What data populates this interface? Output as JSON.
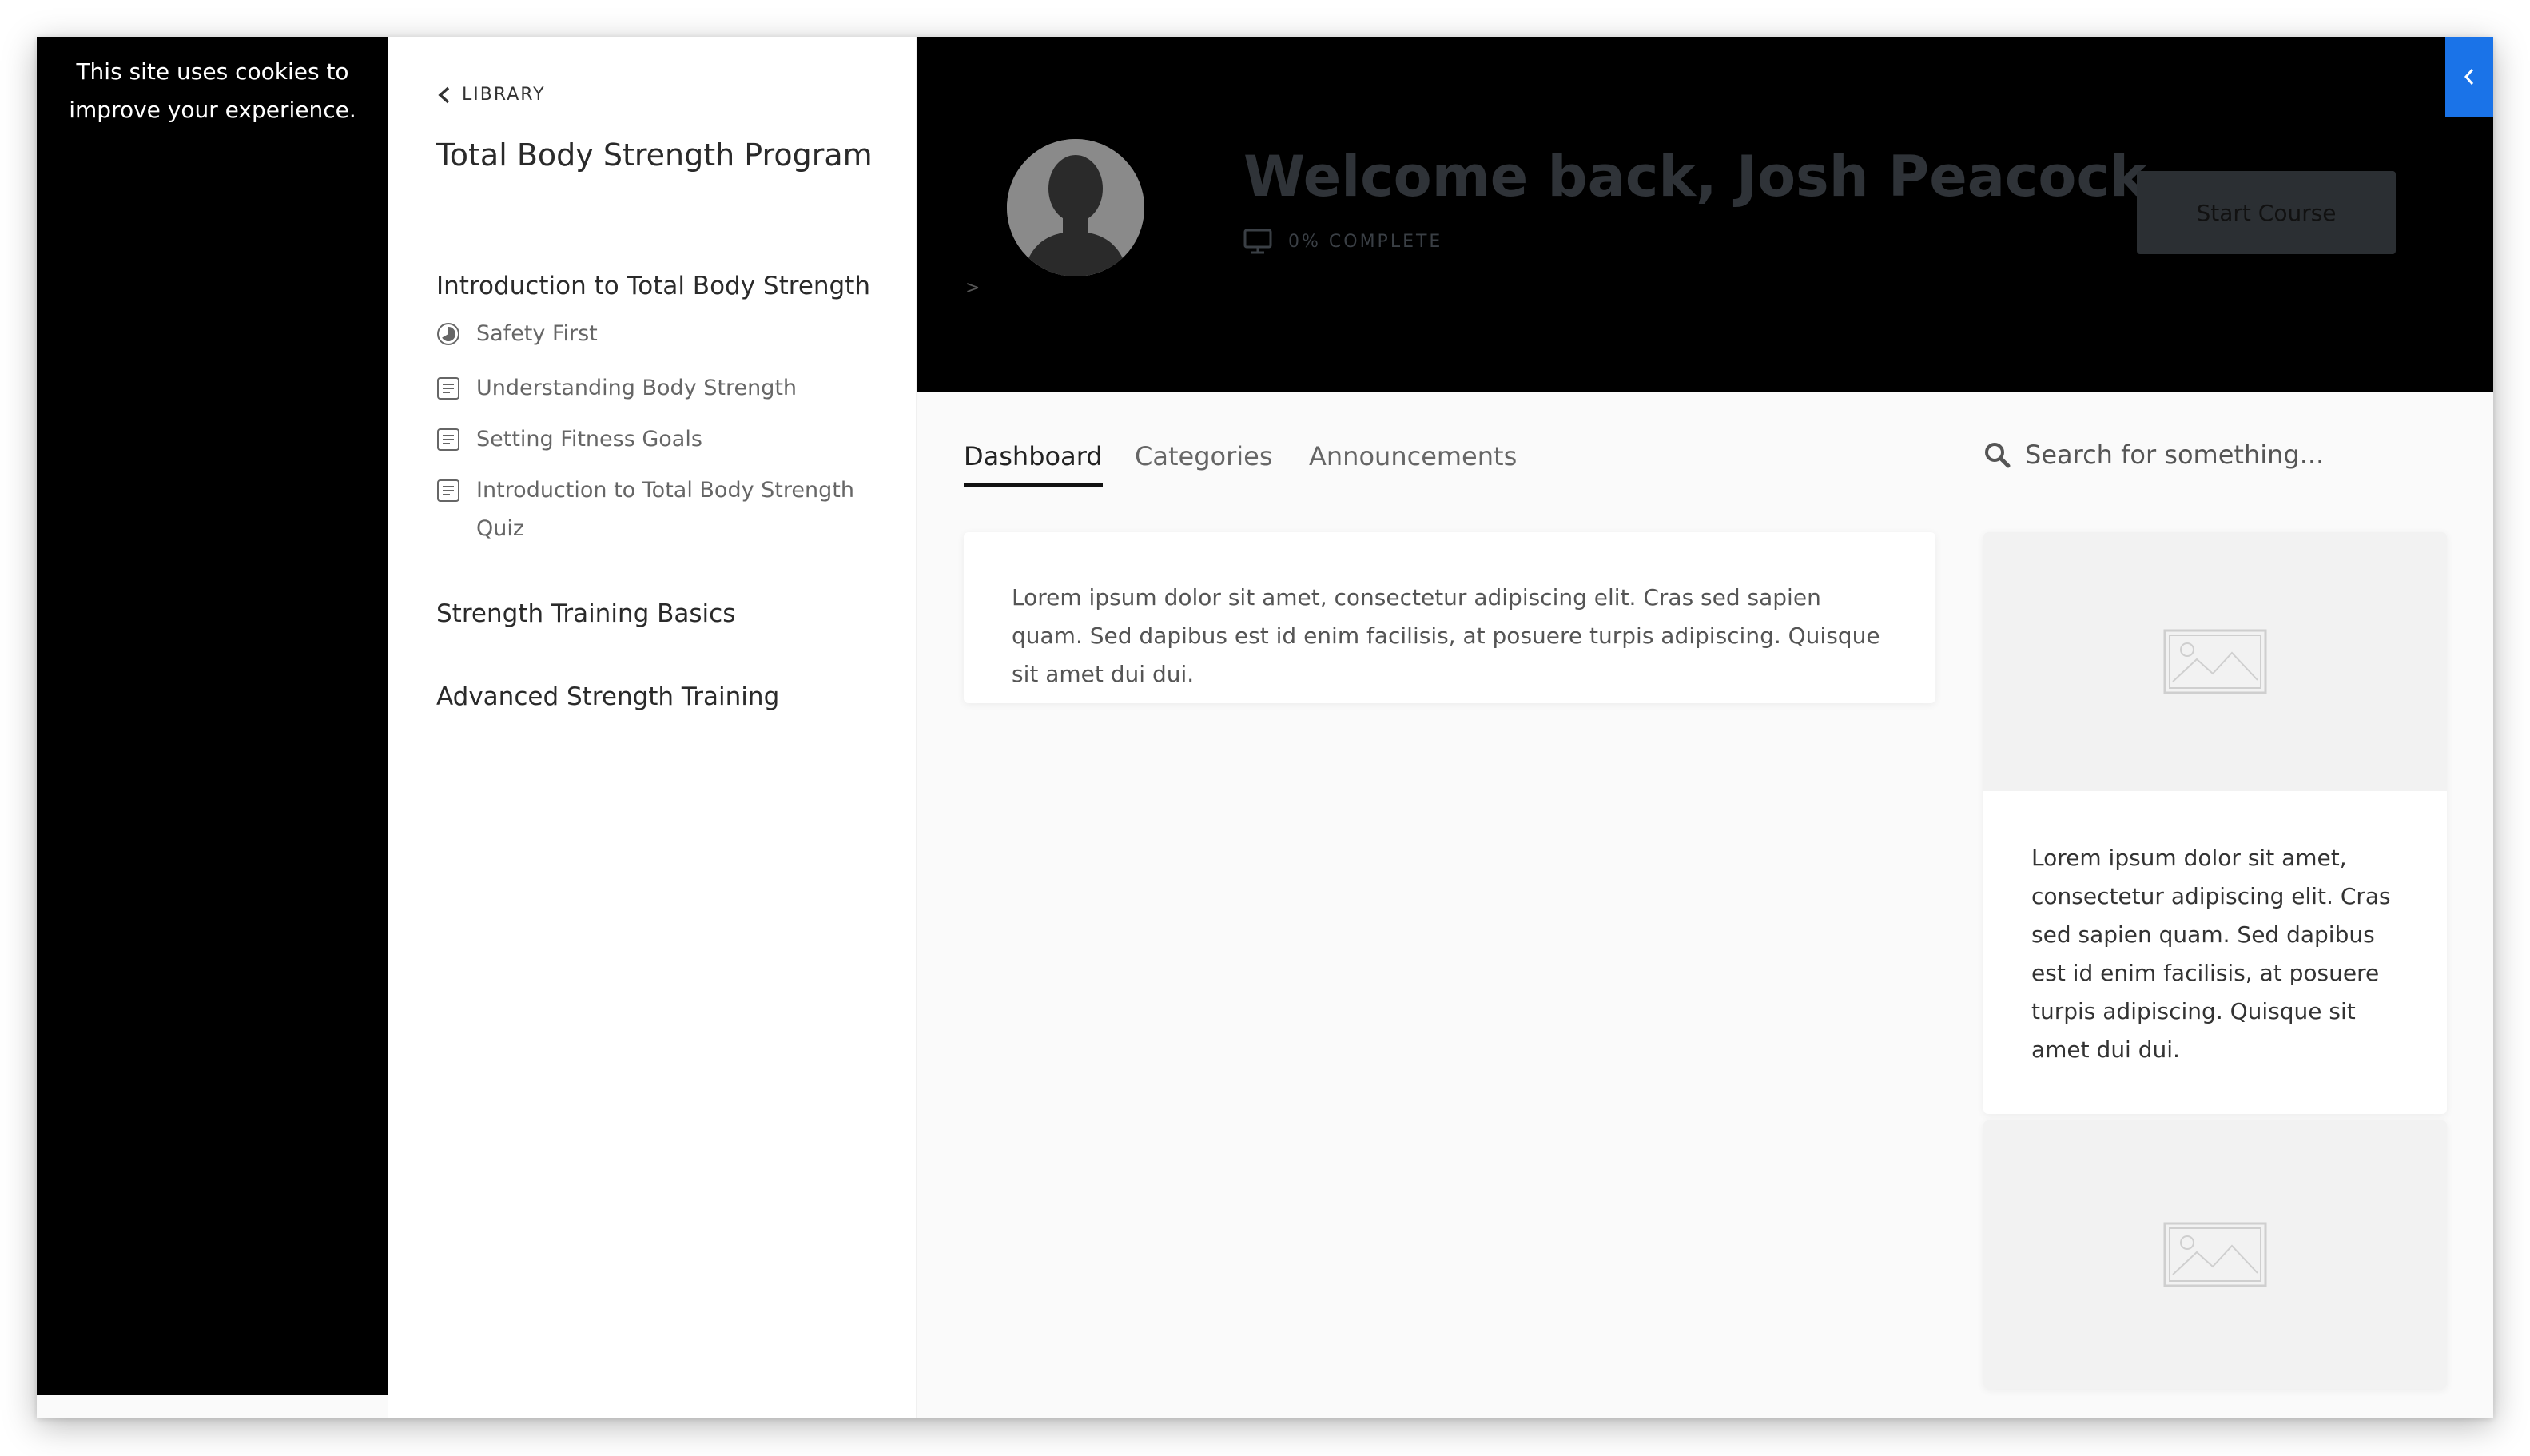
{
  "cookie_notice": {
    "text": "This site uses cookies to improve your experience."
  },
  "sidebar": {
    "back_label": "LIBRARY",
    "course_title": "Total Body Strength Program",
    "sections": [
      {
        "title": "Introduction to Total Body Strength",
        "lessons": [
          {
            "label": "Safety First",
            "icon": "progress-circle-icon"
          },
          {
            "label": "Understanding Body Strength",
            "icon": "document-icon"
          },
          {
            "label": "Setting Fitness Goals",
            "icon": "document-icon"
          },
          {
            "label": "Introduction to Total Body Strength Quiz",
            "icon": "document-icon"
          }
        ]
      },
      {
        "title": "Strength Training Basics",
        "lessons": []
      },
      {
        "title": "Advanced Strength Training",
        "lessons": []
      }
    ]
  },
  "header": {
    "welcome": "Welcome back, Josh Peacock",
    "progress_text": "0% COMPLETE",
    "caret": ">",
    "start_button": "Start Course",
    "colors": {
      "banner_bg": "#000000",
      "collapse_button_bg": "#1a73e8"
    }
  },
  "tabs": [
    {
      "label": "Dashboard",
      "active": true
    },
    {
      "label": "Categories",
      "active": false
    },
    {
      "label": "Announcements",
      "active": false
    }
  ],
  "search": {
    "placeholder": "Search for something..."
  },
  "main_card": {
    "text": "Lorem ipsum dolor sit amet, consectetur adipiscing elit. Cras sed sapien quam. Sed dapibus est id enim facilisis, at posuere turpis adipiscing. Quisque sit amet dui dui."
  },
  "side_cards": [
    {
      "text": "Lorem ipsum dolor sit amet, consectetur adipiscing elit. Cras sed sapien quam. Sed dapibus est id enim facilisis, at posuere turpis adipiscing. Quisque sit amet dui dui."
    },
    {
      "text": ""
    }
  ]
}
